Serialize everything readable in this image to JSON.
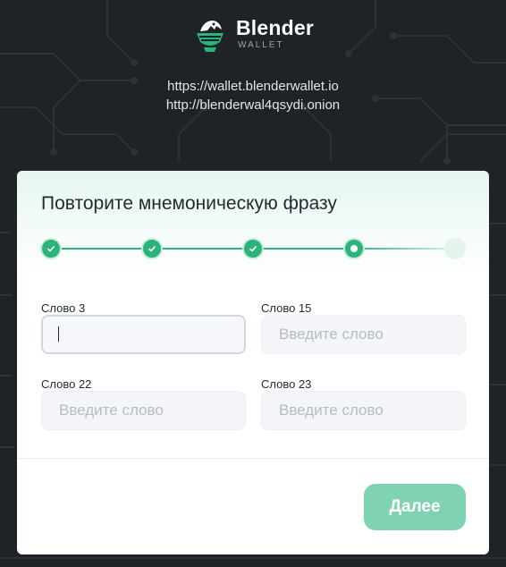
{
  "brand": {
    "name": "Blender",
    "subtitle": "WALLET",
    "logo_icon": "blender-logo-icon"
  },
  "links": {
    "clearnet": "https://wallet.blenderwallet.io",
    "onion": "http://blenderwal4qsydi.onion"
  },
  "card": {
    "title": "Повторите мнемоническую фразу",
    "stepper": {
      "total_steps": 5,
      "completed_steps": 3,
      "current_step": 4
    },
    "fields": [
      {
        "label": "Слово 3",
        "value": "",
        "placeholder": "",
        "focused": true
      },
      {
        "label": "Слово 15",
        "value": "",
        "placeholder": "Введите слово",
        "focused": false
      },
      {
        "label": "Слово 22",
        "value": "",
        "placeholder": "Введите слово",
        "focused": false
      },
      {
        "label": "Слово 23",
        "value": "",
        "placeholder": "Введите слово",
        "focused": false
      }
    ],
    "next_button": "Далее"
  },
  "colors": {
    "accent": "#2bb37b",
    "button": "#7fd3b1",
    "background": "#1f2327"
  }
}
